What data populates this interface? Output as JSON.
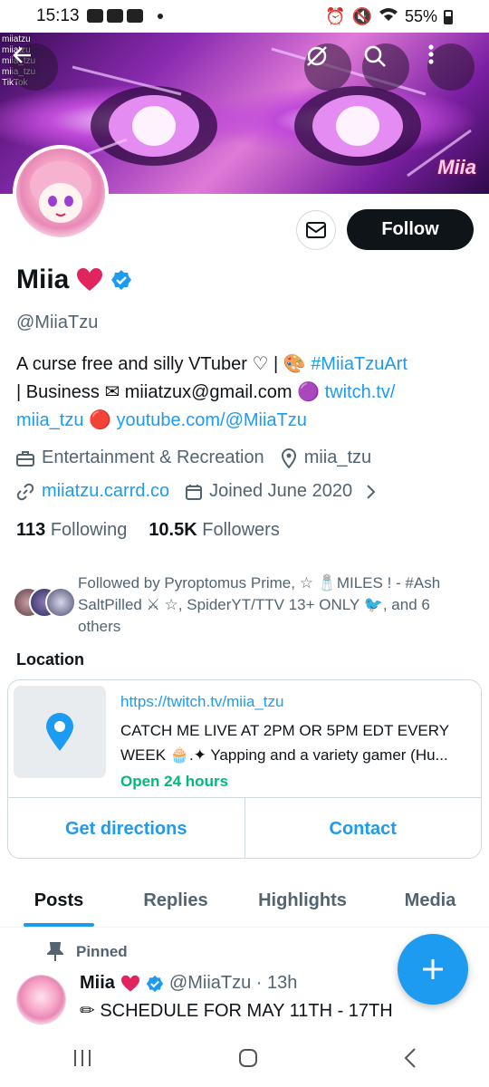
{
  "status_bar": {
    "time": "15:13",
    "battery": "55%"
  },
  "banner": {
    "social_handles": [
      "miiatzu",
      "miiatzu",
      "miia_tzu",
      "miia_tzu"
    ],
    "social_footer": "TikTok",
    "logo_text": "Miia"
  },
  "profile": {
    "name": "Miia",
    "handle": "@MiiaTzu",
    "follow_label": "Follow",
    "bio": {
      "l1_text": "A curse free and silly VTuber ♡ | 🎨 ",
      "l1_link": "#MiiaTzuArt",
      "l2_text": "| Business ✉ miiatzux@gmail.com 🟣 ",
      "l2_link": "twitch.tv/",
      "l3_link1": "miia_tzu",
      "l3_text": " 🔴 ",
      "l3_link2": "youtube.com/@MiiaTzu"
    },
    "category": "Entertainment & Recreation",
    "location": "miia_tzu",
    "website": "miiatzu.carrd.co",
    "joined": "Joined June 2020",
    "following_count": "113",
    "following_label": "Following",
    "followers_count": "10.5K",
    "followers_label": "Followers",
    "followed_by": "Followed by Pyroptomus Prime, ☆ 🧂MILES ! - #Ash SaltPilled ⚔ ☆, SpiderYT/TTV 13+ ONLY 🐦, and 6 others"
  },
  "location_card": {
    "title": "Location",
    "url": "https://twitch.tv/miia_tzu",
    "desc_line1": "CATCH ME LIVE AT 2PM OR 5PM EDT EVERY",
    "desc_line2": "WEEK 🧁.✦ Yapping and a variety gamer (Hu...",
    "hours": "Open 24 hours",
    "directions": "Get directions",
    "contact": "Contact"
  },
  "tabs": [
    "Posts",
    "Replies",
    "Highlights",
    "Media"
  ],
  "pinned_post": {
    "pinned_label": "Pinned",
    "author": "Miia",
    "meta": "@MiiaTzu · 13h",
    "text": "✏ SCHEDULE FOR MAY 11TH - 17TH"
  },
  "colors": {
    "accent": "#1d9bf0",
    "green": "#00ba7c",
    "text_secondary": "#536471",
    "heart": "#e0245e"
  }
}
